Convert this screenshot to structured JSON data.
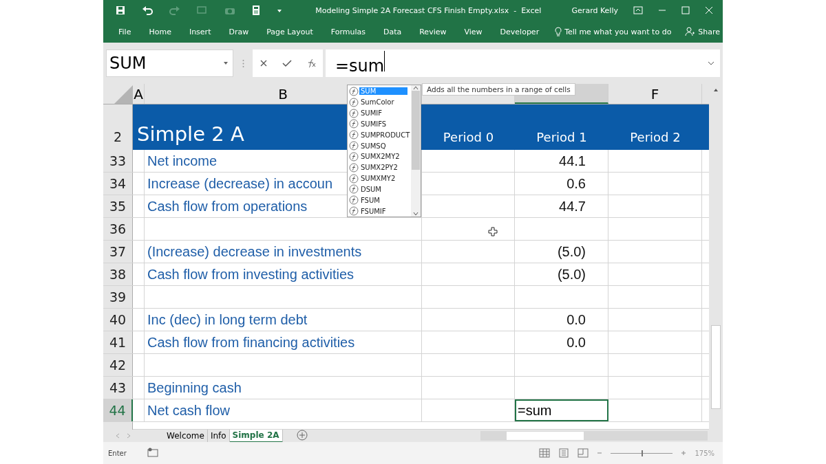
{
  "title_bar": {
    "title": "Modeling Simple 2A Forecast CFS Finish Empty.xlsx  -  Excel",
    "user": "Gerard Kelly"
  },
  "ribbon_tabs": [
    {
      "label": "File"
    },
    {
      "label": "Home"
    },
    {
      "label": "Insert"
    },
    {
      "label": "Draw"
    },
    {
      "label": "Page Layout"
    },
    {
      "label": "Formulas"
    },
    {
      "label": "Data"
    },
    {
      "label": "Review"
    },
    {
      "label": "View"
    },
    {
      "label": "Developer"
    }
  ],
  "tell_me": {
    "placeholder": "Tell me what you want to do"
  },
  "share": "Share",
  "name_box": {
    "value": "SUM"
  },
  "formula_bar": {
    "value": "=sum"
  },
  "columns": [
    {
      "label": "A",
      "selected": false
    },
    {
      "label": "B",
      "selected": false
    },
    {
      "selected": false
    },
    {
      "selected": true
    },
    {
      "label": "F",
      "selected": false
    }
  ],
  "header_row": {
    "number": "2",
    "title": "Simple 2 A",
    "periods": [
      "Period 0",
      "Period 1",
      "Period 2"
    ]
  },
  "rows": [
    {
      "number": "33",
      "label": "Net income",
      "value": "44.1",
      "selected": false
    },
    {
      "number": "34",
      "label": "Increase (decrease) in accoun",
      "value": "0.6",
      "selected": false
    },
    {
      "number": "35",
      "label": "Cash flow from operations",
      "value": "44.7",
      "selected": false
    },
    {
      "number": "36",
      "selected": false
    },
    {
      "number": "37",
      "label": "(Increase) decrease in investments",
      "value": "(5.0)",
      "selected": false
    },
    {
      "number": "38",
      "label": "Cash flow from investing activities",
      "value": "(5.0)",
      "selected": false
    },
    {
      "number": "39",
      "selected": false
    },
    {
      "number": "40",
      "label": "Inc (dec) in long term debt",
      "value": "0.0",
      "selected": false
    },
    {
      "number": "41",
      "label": "Cash flow from financing activities",
      "value": "0.0",
      "selected": false
    },
    {
      "number": "42",
      "selected": false
    },
    {
      "number": "43",
      "label": "Beginning cash",
      "selected": false
    },
    {
      "number": "44",
      "label": "Net cash flow",
      "value": "=sum",
      "selected": true
    }
  ],
  "autocomplete": [
    {
      "label": "SUM",
      "selected": true
    },
    {
      "label": "SumColor",
      "selected": false
    },
    {
      "label": "SUMIF",
      "selected": false
    },
    {
      "label": "SUMIFS",
      "selected": false
    },
    {
      "label": "SUMPRODUCT",
      "selected": false
    },
    {
      "label": "SUMSQ",
      "selected": false
    },
    {
      "label": "SUMX2MY2",
      "selected": false
    },
    {
      "label": "SUMX2PY2",
      "selected": false
    },
    {
      "label": "SUMXMY2",
      "selected": false
    },
    {
      "label": "DSUM",
      "selected": false
    },
    {
      "label": "FSUM",
      "selected": false
    },
    {
      "label": "FSUMIF",
      "selected": false
    }
  ],
  "tooltip": "Adds all the numbers in a range of cells",
  "sheet_tabs": [
    {
      "label": "Welcome",
      "selected": false
    },
    {
      "label": "Info",
      "selected": false
    },
    {
      "label": "Simple 2A",
      "selected": true
    }
  ],
  "status_bar": {
    "mode": "Enter",
    "zoom": "175%",
    "zoom_level": {
      "level": 0.5
    }
  }
}
